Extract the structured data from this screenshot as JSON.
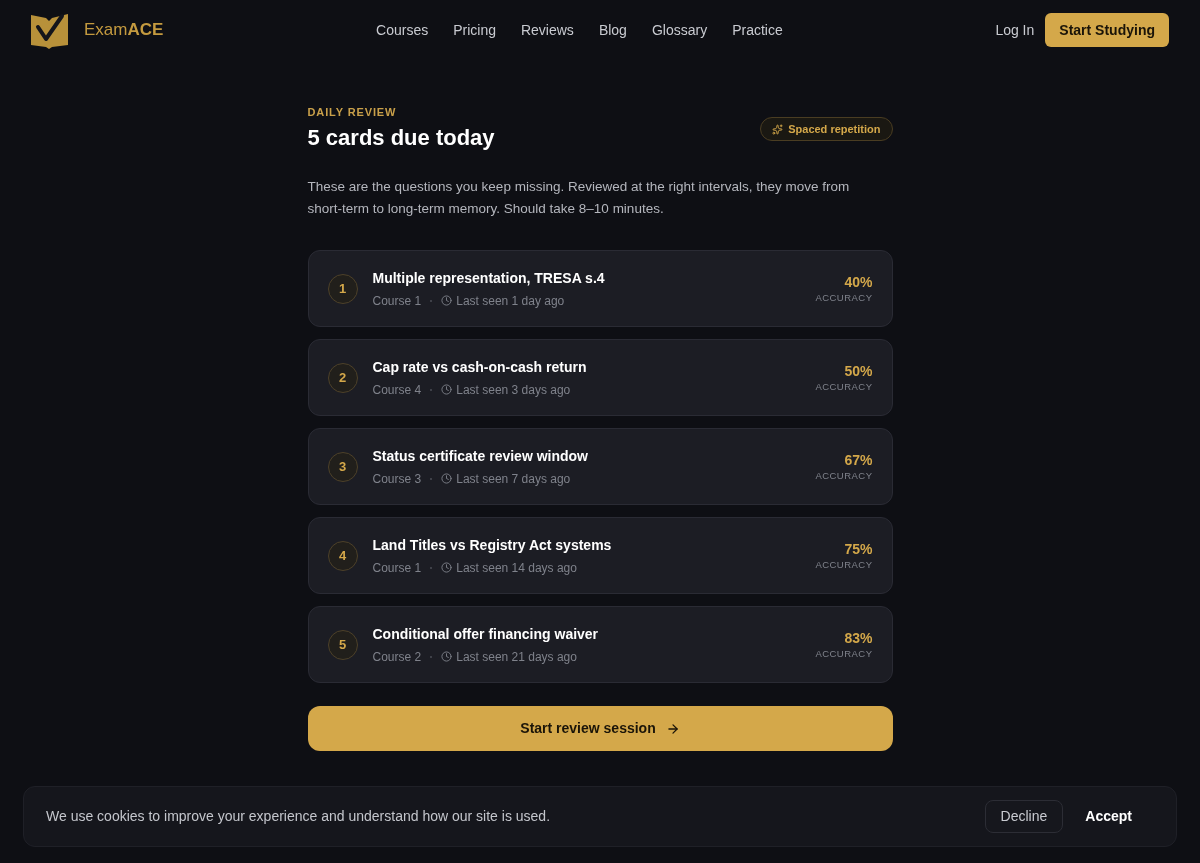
{
  "nav": {
    "logo": "Exam**ACE**",
    "links": [
      "Courses",
      "Pricing",
      "Reviews",
      "Blog",
      "Glossary",
      "Practice"
    ],
    "login": "Log In",
    "cta": "Start Studying"
  },
  "header": {
    "eyebrow": "DAILY REVIEW",
    "title": "5 cards due today",
    "badge": "Spaced repetition"
  },
  "description": "These are the questions you keep missing. Reviewed at the right intervals, they move from short-term to long-term memory. Should take 8–10 minutes.",
  "cards": [
    {
      "number": "1",
      "title": "Multiple representation, TRESA s.4",
      "course": "Course 1",
      "last_seen": "Last seen 1 day ago",
      "accuracy": "40%",
      "accuracy_label": "ACCURACY"
    },
    {
      "number": "2",
      "title": "Cap rate vs cash-on-cash return",
      "course": "Course 4",
      "last_seen": "Last seen 3 days ago",
      "accuracy": "50%",
      "accuracy_label": "ACCURACY"
    },
    {
      "number": "3",
      "title": "Status certificate review window",
      "course": "Course 3",
      "last_seen": "Last seen 7 days ago",
      "accuracy": "67%",
      "accuracy_label": "ACCURACY"
    },
    {
      "number": "4",
      "title": "Land Titles vs Registry Act systems",
      "course": "Course 1",
      "last_seen": "Last seen 14 days ago",
      "accuracy": "75%",
      "accuracy_label": "ACCURACY"
    },
    {
      "number": "5",
      "title": "Conditional offer financing waiver",
      "course": "Course 2",
      "last_seen": "Last seen 21 days ago",
      "accuracy": "83%",
      "accuracy_label": "ACCURACY"
    }
  ],
  "start_button": "Start review session",
  "cookie_banner": {
    "text": "We use cookies to improve your experience and understand how our site is used.",
    "buttons": [
      {
        "label": "Decline",
        "kind": "secondary"
      },
      {
        "label": "Accept",
        "kind": "primary"
      }
    ]
  }
}
